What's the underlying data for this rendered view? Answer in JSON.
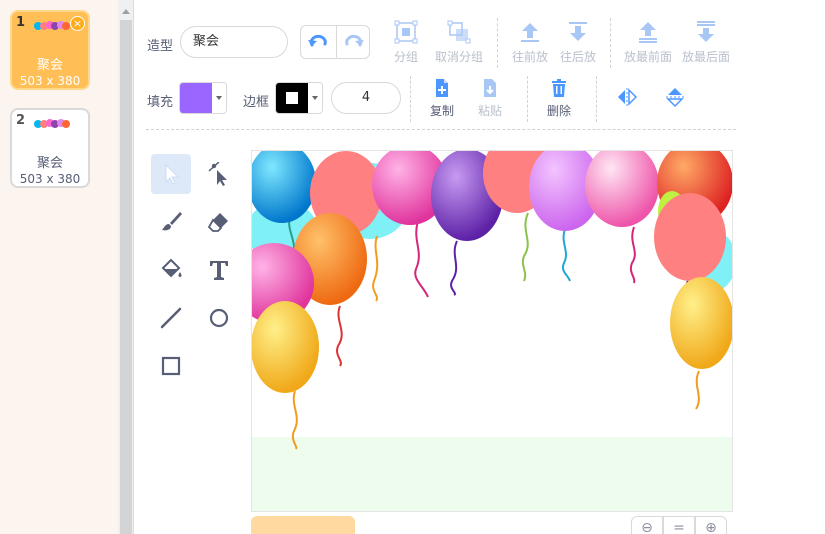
{
  "costumes": [
    {
      "number": "1",
      "name": "聚会",
      "size": "503 x 380",
      "selected": true
    },
    {
      "number": "2",
      "name": "聚会",
      "size": "503 x 380",
      "selected": false
    }
  ],
  "toolbar": {
    "costume_label": "造型",
    "costume_name": "聚会",
    "group_label": "分组",
    "ungroup_label": "取消分组",
    "forward_label": "往前放",
    "backward_label": "往后放",
    "front_label": "放最前面",
    "back_label": "放最后面",
    "fill_label": "填充",
    "outline_label": "边框",
    "outline_width": "4",
    "copy_label": "复制",
    "paste_label": "粘贴",
    "delete_label": "删除"
  },
  "colors": {
    "fill": "#9966ff",
    "outline": "#000000",
    "accent": "#4c97ff",
    "selected_costume": "#ffbf56"
  },
  "tools": [
    "select",
    "reshape",
    "brush",
    "eraser",
    "fill",
    "text",
    "line",
    "circle",
    "rectangle"
  ],
  "bottom": {
    "zoom_out_icon": "zoom-out-icon",
    "zoom_reset_icon": "zoom-reset-icon",
    "zoom_in_icon": "zoom-in-icon"
  }
}
